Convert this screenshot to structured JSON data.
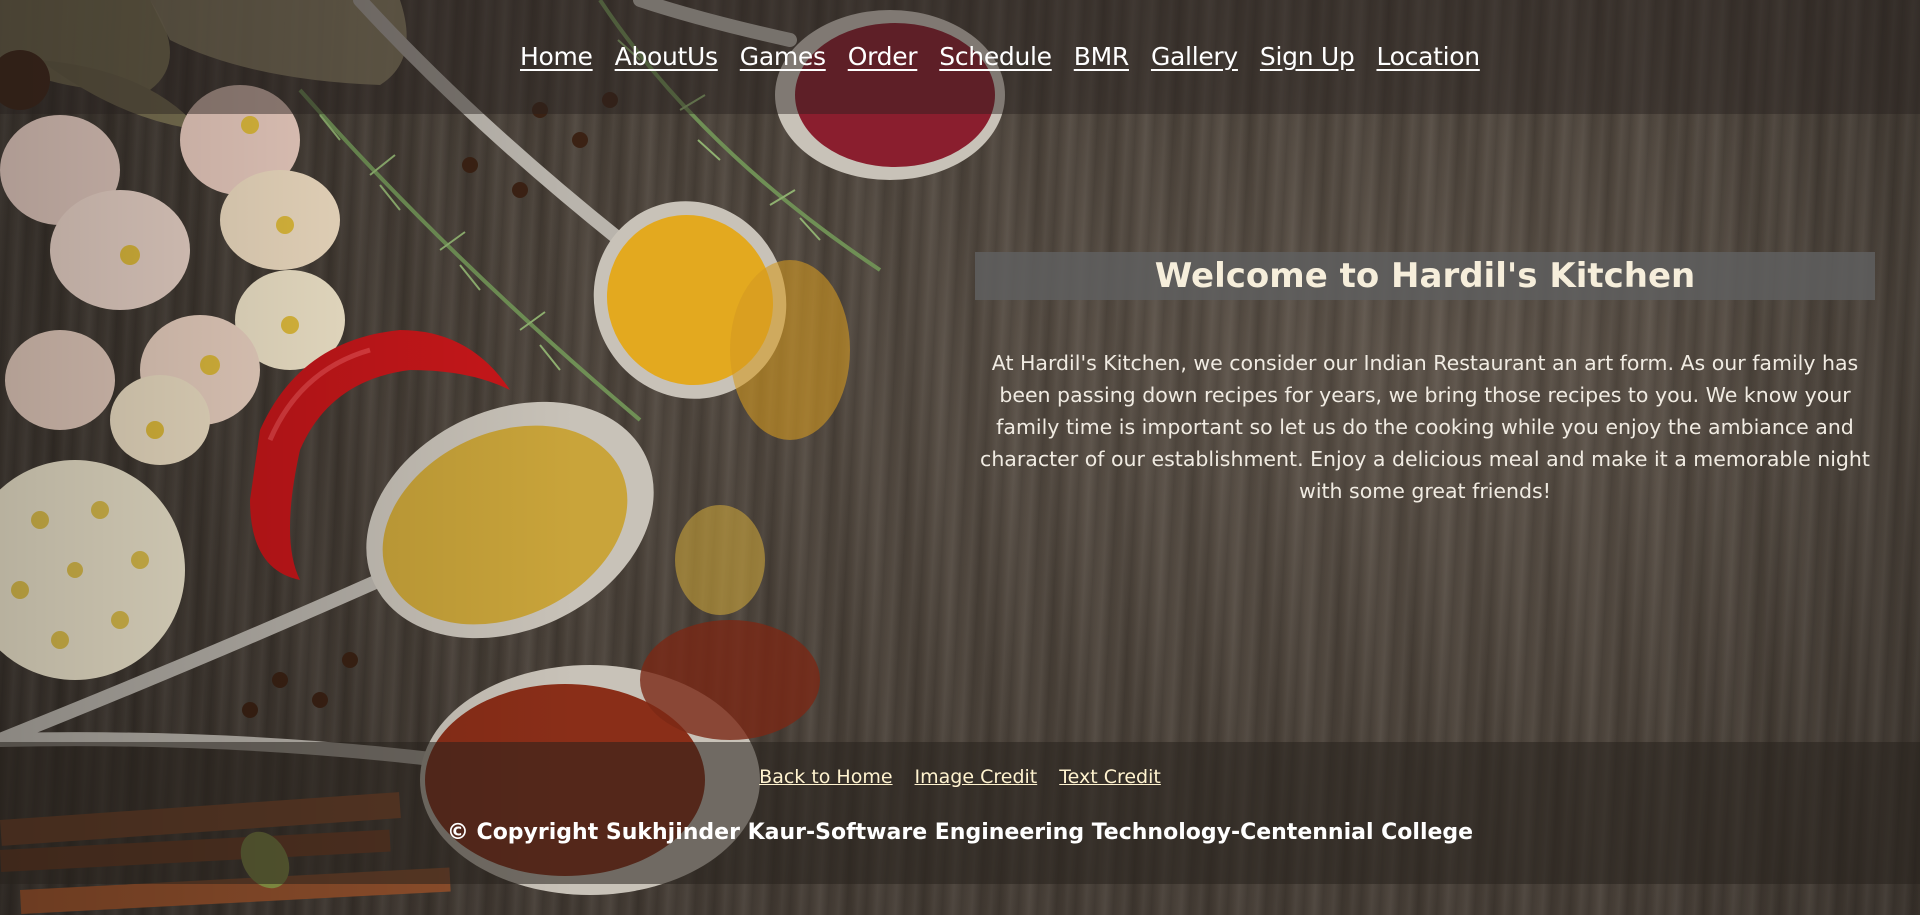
{
  "nav": {
    "items": [
      {
        "label": "Home"
      },
      {
        "label": "AboutUs"
      },
      {
        "label": "Games"
      },
      {
        "label": "Order"
      },
      {
        "label": "Schedule"
      },
      {
        "label": "BMR"
      },
      {
        "label": "Gallery"
      },
      {
        "label": "Sign Up"
      },
      {
        "label": "Location"
      }
    ]
  },
  "main": {
    "title": "Welcome to Hardil's Kitchen",
    "intro": "At Hardil's Kitchen, we consider our Indian Restaurant an art form. As our family has been passing down recipes for years, we bring those recipes to you. We know your family time is important so let us do the cooking while you enjoy the ambiance and character of our establishment. Enjoy a delicious meal and make it a memorable night with some great friends!"
  },
  "footer": {
    "links": [
      {
        "label": "Back to Home"
      },
      {
        "label": "Image Credit"
      },
      {
        "label": "Text Credit"
      }
    ],
    "copyright": "© Copyright Sukhjinder Kaur-Software Engineering Technology-Centennial College"
  },
  "colors": {
    "welcome_bar": "#5f5f5f",
    "title_text": "#f6eedb",
    "footer_link": "#fff3cf"
  }
}
